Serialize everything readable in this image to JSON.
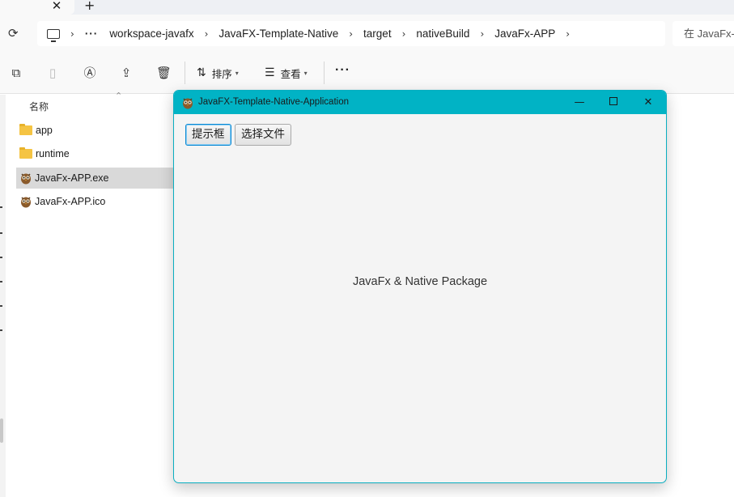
{
  "explorer": {
    "tab_close": "✕",
    "tab_new": "+",
    "breadcrumbs": [
      "workspace-javafx",
      "JavaFX-Template-Native",
      "target",
      "nativeBuild",
      "JavaFx-APP"
    ],
    "crumb_overflow": "···",
    "search_placeholder": "在 JavaFx-APP 中搜索",
    "toolbar": {
      "sort_label": "排序",
      "view_label": "查看",
      "more": "···"
    },
    "column_name": "名称",
    "files": [
      {
        "name": "app",
        "type": "folder",
        "selected": false
      },
      {
        "name": "runtime",
        "type": "folder",
        "selected": false
      },
      {
        "name": "JavaFx-APP.exe",
        "type": "exe",
        "selected": true
      },
      {
        "name": "JavaFx-APP.ico",
        "type": "ico",
        "selected": false
      }
    ]
  },
  "app_window": {
    "title": "JavaFX-Template-Native-Application",
    "buttons": {
      "alert": "提示框",
      "choose_file": "选择文件"
    },
    "center_label": "JavaFx & Native Package",
    "accent_color": "#01b3c5"
  }
}
